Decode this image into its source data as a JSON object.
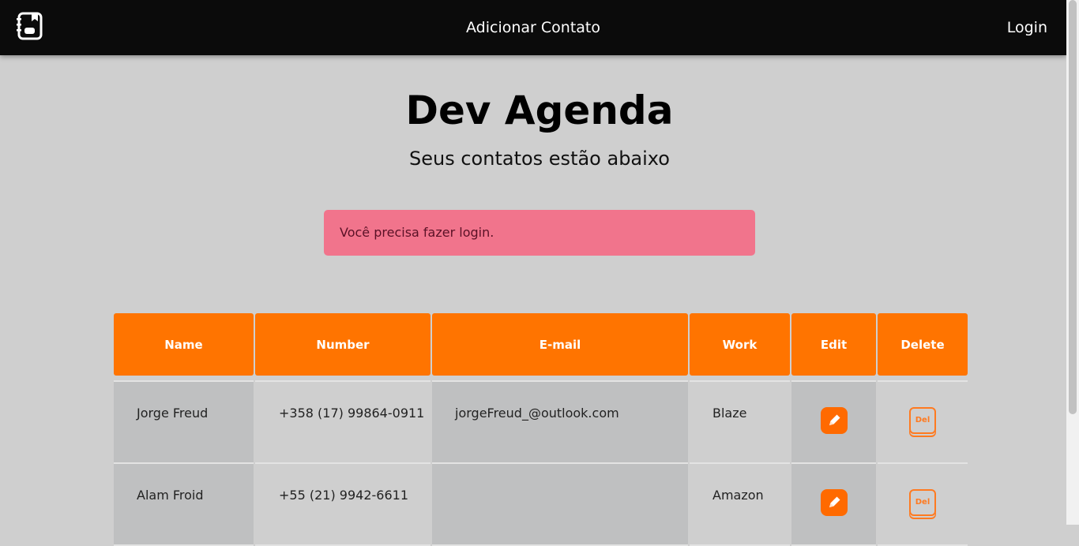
{
  "navbar": {
    "logo_icon": "address-book-icon",
    "add_contact": "Adicionar Contato",
    "login": "Login"
  },
  "header": {
    "title": "Dev Agenda",
    "subtitle": "Seus contatos estão abaixo"
  },
  "alert": {
    "message": "Você precisa fazer login.",
    "color": "#f1748c"
  },
  "table": {
    "accent_color": "#ff7400",
    "columns": [
      "Name",
      "Number",
      "E-mail",
      "Work",
      "Edit",
      "Delete"
    ],
    "rows": [
      {
        "name": "Jorge Freud",
        "number": "+358 (17) 99864-0911",
        "email": "jorgeFreud_@outlook.com",
        "work": "Blaze",
        "edit_icon": "pencil-icon",
        "delete_label": "Del"
      },
      {
        "name": "Alam Froid",
        "number": "+55 (21) 9942-6611",
        "email": "",
        "work": "Amazon",
        "edit_icon": "pencil-icon",
        "delete_label": "Del"
      }
    ]
  }
}
